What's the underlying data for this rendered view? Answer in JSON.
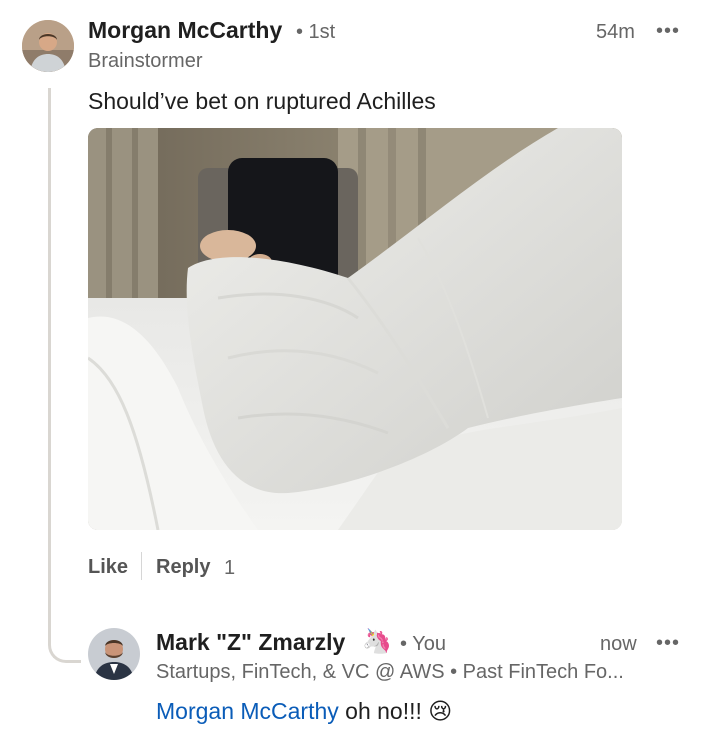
{
  "comment": {
    "author": "Morgan McCarthy",
    "connection": "• 1st",
    "headline": "Brainstormer",
    "time": "54m",
    "more": "•••",
    "text": "Should’ve bet on ruptured Achilles",
    "actions": {
      "like": "Like",
      "reply": "Reply",
      "reply_count": "1"
    }
  },
  "reply": {
    "author": "Mark \"Z\" Zmarzly",
    "badge_emoji": "🦄",
    "connection": "• You",
    "headline": "Startups, FinTech, & VC @ AWS • Past FinTech Fo...",
    "time": "now",
    "more": "•••",
    "mention": "Morgan McCarthy",
    "text": "oh no!!!",
    "emoji": "😢"
  },
  "colors": {
    "mention": "#0a5cb8",
    "thread_line": "#d9d6d1",
    "muted": "#666666"
  }
}
